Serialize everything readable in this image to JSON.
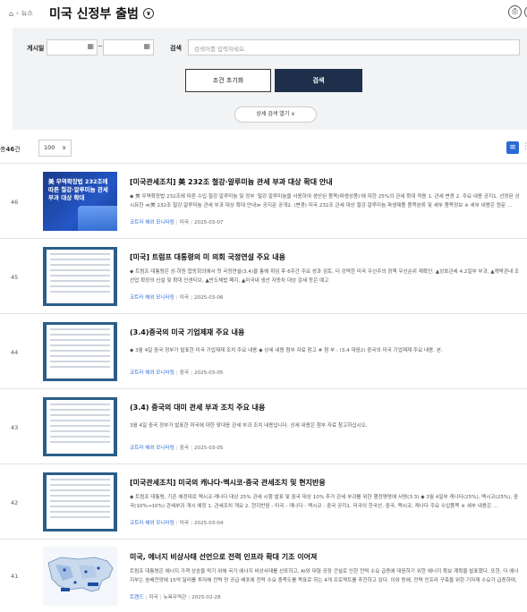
{
  "breadcrumb": {
    "home_icon": "home-icon",
    "separator": "›",
    "section": "뉴스"
  },
  "page_title": "미국 신정부 출범",
  "title_dropdown_icon": "chevron-down-circle-icon",
  "header_tools": [
    {
      "icon": "print-icon",
      "glyph": "⎙"
    },
    {
      "icon": "share-icon",
      "glyph": "("
    }
  ],
  "search": {
    "date_label": "게시일",
    "date_from": "",
    "date_to": "",
    "date_separator": "~",
    "calendar_icon": "calendar-icon",
    "keyword_label": "검색",
    "keyword_placeholder": "검색어를 입력하세요.",
    "reset_label": "조건 초기화",
    "search_label": "검색",
    "detail_label": "상세 검색 열기 ∨"
  },
  "results": {
    "total_prefix": "총",
    "total_count": "46",
    "total_suffix": "건",
    "page_size": "100",
    "view_list_icon": "list-view-icon",
    "view_grid_icon": "grid-view-icon"
  },
  "items": [
    {
      "num": "46",
      "thumb_type": "banner",
      "thumb_text": "美 무역확장법 232조에 따른 철강·알루미늄 관세 부과 대상 확대",
      "title": "[미국관세조치] 美 232조 철강·알루미늄 관세 부과 대상 확대 안내",
      "body": "◆ 美 무역확장법 232조에 따른 수입 철강·알루미늄 및 정부 '철강·알루미늄을 사용하여 생산된 품목(파생상품)'에 대한 25%의 관세 확대 적용 1. 관세 변경 2. 주요 내용 공지1. 선정된 상시유한 ≪美 232조 철강·알루미늄 관세 부과 대상 확대 안내≫ 공지문 공개2. (변경) 미국 232조 관세 대상 철강·알루미늄 파생제품 품목분류 및 세부 품목정보 ※ 세부 내용은 원문 ...",
      "source": "코트라 해외 모니터링",
      "country": "미국",
      "date": "2025-03-07"
    },
    {
      "num": "45",
      "thumb_type": "doc",
      "title": "[미국] 트럼프 대통령의 미 의회 국정연설 주요 내용",
      "body": "◆ 트럼프 대통령은 상·하원 합동회의에서 첫 국정연설(3.4)을 통해 취임 후 6주간 주요 성과 검토, 더 강력한 미국 우선주의 정책 우선순위 제확인: ▲상호관세 4.2일부 부과, ▲캐박관내 조선업 확장의 신설 및 확대 인센티브, ▲반도체법 폐지, ▲미국내 생산 자동차 대상 감세 등은 예고",
      "source": "코트라 해외 모니터링",
      "country": "미국",
      "date": "2025-03-06"
    },
    {
      "num": "44",
      "thumb_type": "doc",
      "title": "(3.4)중국의 미국 기업제재 주요 내용",
      "body": "◆ 3월 4일 중국 정부가 발표한 미국 기업제재 조치 주요 내용 ◆ 상세 내용 첨부 자료 참고 # 첨 부 : (3.4 대응2) 중국의 미국 기업제재 주요 내용. 본.",
      "source": "코트라 해외 모니터링",
      "country": "중국",
      "date": "2025-03-05"
    },
    {
      "num": "43",
      "thumb_type": "doc",
      "title": "(3.4) 중국의 대미 관세 부과 조치 주요 내용",
      "body": "3월 4일 중국 정부가 발표한 미국에 대한 맞대응 관세 부과 조치 내용입니다. 상세 내용은 첨부 자료 참고하십시오.",
      "source": "코트라 해외 모니터링",
      "country": "중국",
      "date": "2025-03-05"
    },
    {
      "num": "42",
      "thumb_type": "doc",
      "title": "[미국관세조치] 미국의 캐나다·멕시코·중국 관세조치 및 현지반응",
      "body": "◆ 트럼프 대통령, 기존 예정대로 멕시코·캐나다 대상 25% 관세 시행 발표 및 중국 대상 10% 추가 관세 부과를 위한 행정명령에 서명(3.3) ◆ 3월 4일부 캐나다(25%), 멕시코(25%), 중국(10%→10%) 관세부과 개시 예정 1. 관세조치 개요 2. 현지반응 - 미국 - 캐나다 - 멕시코 - 중국 공지1. 미국의 한국산, 중국, 멕시코, 캐나다 주요 수입품목 ※ 세부 내용은 ...",
      "source": "코트라 해외 모니터링",
      "country": "미국",
      "date": "2025-03-04"
    },
    {
      "num": "41",
      "thumb_type": "map",
      "title": "미국, 에너지 비상사태 선언으로 전력 인프라 확대 기조 이어져",
      "body": "트럼프 대통령은 에너지 가격 상승을 막기 위해 국가 에너지 비상사태를 선포하고, AI와 대형 공장 건설로 인한 전력 수요 급증에 대응하기 위한 에너지 확보 계획을 발표했다. 또한, 더 에너지부는 송배전망에 15억 달러를 투자해 전력 망 공급 배포에 전력 수요 충족도를 목표로 하는 4개 프로젝트를 추진하고 있다. 이와 동에, 전력 인프라 구축을 위한 기자재 수요가 급증하며, 전력 기기 시장에서 예비 ...",
      "source": "트렌드",
      "country": "미국",
      "city": "뉴욕무역관",
      "date": "2025-02-28"
    }
  ]
}
